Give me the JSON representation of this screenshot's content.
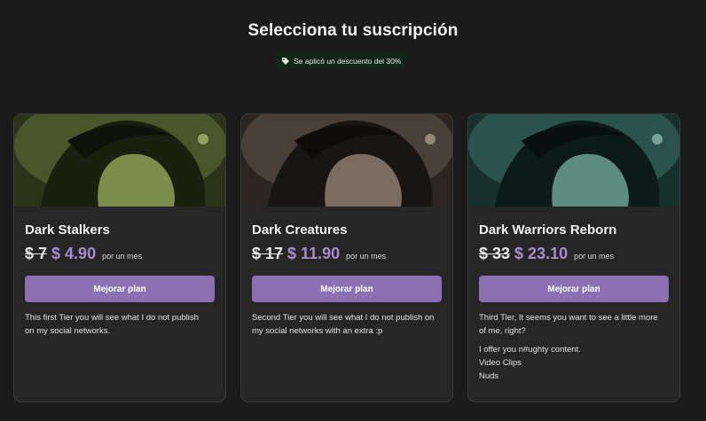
{
  "header": {
    "title": "Selecciona tu suscripción",
    "discount_text": "Se aplicó un descuento del 30%"
  },
  "colors": {
    "background": "#1b1b1b",
    "card": "#262626",
    "accent": "#8b70b2",
    "price": "#a98ccf",
    "discount_bg": "#11241a"
  },
  "tiers": [
    {
      "name": "Dark Stalkers",
      "old_price": "$ 7",
      "new_price": "$ 4.90",
      "period": "por un mes",
      "button_label": "Mejorar plan",
      "description": [
        "This first Tier you will see what I do not publish on my social networks."
      ],
      "image_tint": "#6f7f45"
    },
    {
      "name": "Dark Creatures",
      "old_price": "$ 17",
      "new_price": "$ 11.90",
      "period": "por un mes",
      "button_label": "Mejorar plan",
      "description": [
        "Second Tier you will see what I do not publish on my social networks with an extra :p"
      ],
      "image_tint": "#6d5f54"
    },
    {
      "name": "Dark Warriors Reborn",
      "old_price": "$ 33",
      "new_price": "$ 23.10",
      "period": "por un mes",
      "button_label": "Mejorar plan",
      "description": [
        "Third Tier, It seems you want to see a little more of me, right?",
        "I offer you n#ughty content.",
        "Video Clips",
        "Nuds"
      ],
      "image_tint": "#4f7f75"
    }
  ]
}
